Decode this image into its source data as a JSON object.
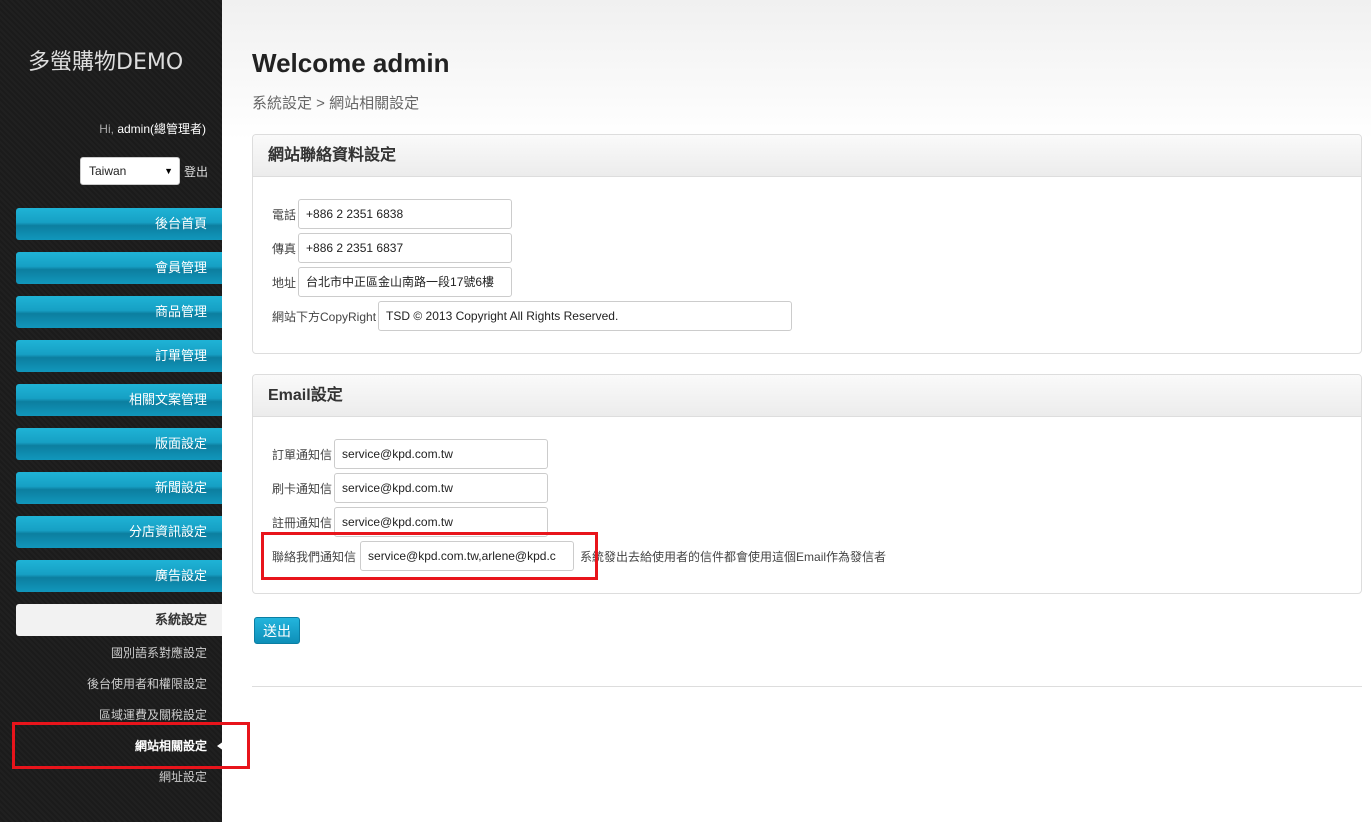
{
  "sidebar": {
    "site_title": "多螢購物DEMO",
    "greet_prefix": "Hi,",
    "user": "admin(總管理者)",
    "language": "Taiwan",
    "logout": "登出",
    "menu": [
      {
        "label": "後台首頁"
      },
      {
        "label": "會員管理"
      },
      {
        "label": "商品管理"
      },
      {
        "label": "訂單管理"
      },
      {
        "label": "相關文案管理"
      },
      {
        "label": "版面設定"
      },
      {
        "label": "新聞設定"
      },
      {
        "label": "分店資訊設定"
      },
      {
        "label": "廣告設定"
      },
      {
        "label": "系統設定"
      }
    ],
    "submenu": [
      {
        "label": "國別語系對應設定"
      },
      {
        "label": "後台使用者和權限設定"
      },
      {
        "label": "區域運費及關稅設定"
      },
      {
        "label": "網站相關設定"
      },
      {
        "label": "網址設定"
      }
    ]
  },
  "main": {
    "title": "Welcome admin",
    "breadcrumb": "系統設定 > 網站相關設定",
    "contact_panel": {
      "title": "網站聯絡資料設定",
      "fields": [
        {
          "label": "電話",
          "value": "+886 2 2351 6838"
        },
        {
          "label": "傳真",
          "value": "+886 2 2351 6837"
        },
        {
          "label": "地址",
          "value": "台北市中正區金山南路一段17號6樓"
        },
        {
          "label": "網站下方CopyRight",
          "value": "TSD © 2013 Copyright All Rights Reserved."
        }
      ]
    },
    "email_panel": {
      "title": "Email設定",
      "fields": [
        {
          "label": "訂單通知信",
          "value": "service@kpd.com.tw"
        },
        {
          "label": "刷卡通知信",
          "value": "service@kpd.com.tw"
        },
        {
          "label": "註冊通知信",
          "value": "service@kpd.com.tw"
        },
        {
          "label": "聯絡我們通知信",
          "value": "service@kpd.com.tw,arlene@kpd.c"
        }
      ],
      "note": "系統發出去給使用者的信件都會使用這個Email作為發信者"
    },
    "submit_label": "送出"
  },
  "colors": {
    "menu_accent": "#1aa9cf",
    "highlight": "#e8141b",
    "sidebar_bg": "#1b1b1b"
  }
}
